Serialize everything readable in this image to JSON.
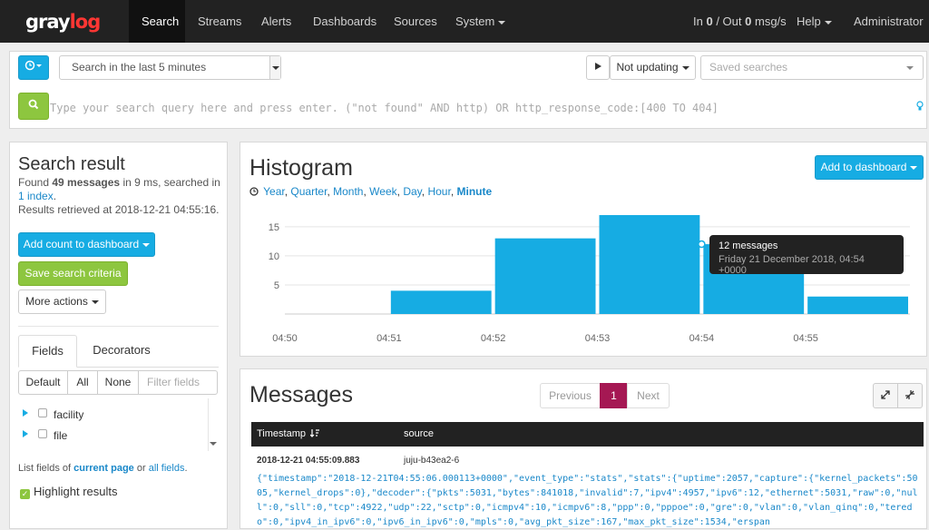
{
  "navbar": {
    "logo_gray": "gray",
    "logo_log": "log",
    "items": [
      "Search",
      "Streams",
      "Alerts",
      "Dashboards",
      "Sources",
      "System"
    ],
    "throughput_in_label": "In",
    "throughput_in": "0",
    "throughput_out_label": "/ Out",
    "throughput_out": "0",
    "throughput_unit": "msg/s",
    "help": "Help",
    "user": "Administrator"
  },
  "search": {
    "time_range": "Search in the last 5 minutes",
    "refresh": "Not updating",
    "saved_searches": "Saved searches",
    "query_placeholder": "Type your search query here and press enter. (\"not found\" AND http) OR http_response_code:[400 TO 404]"
  },
  "sidebar": {
    "title": "Search result",
    "found_prefix": "Found",
    "found_count": "49 messages",
    "found_mid": "in 9 ms, searched in",
    "found_index": "1 index",
    "retrieved": "Results retrieved at 2018-12-21 04:55:16.",
    "add_count": "Add count to dashboard",
    "save_search": "Save search criteria",
    "more_actions": "More actions",
    "tabs": [
      "Fields",
      "Decorators"
    ],
    "filter_buttons": [
      "Default",
      "All",
      "None"
    ],
    "filter_placeholder": "Filter fields",
    "fields": [
      "facility",
      "file"
    ],
    "list_fields_prefix": "List fields of",
    "current_page": "current page",
    "or": "or",
    "all_fields": "all fields",
    "highlight": "Highlight results"
  },
  "histogram": {
    "title": "Histogram",
    "add_to_dashboard": "Add to dashboard",
    "resolutions": [
      "Year",
      "Quarter",
      "Month",
      "Week",
      "Day",
      "Hour",
      "Minute"
    ],
    "active_resolution": "Minute",
    "tooltip_value": "12 messages",
    "tooltip_time": "Friday 21 December 2018, 04:54 +0000"
  },
  "chart_data": {
    "type": "bar",
    "categories": [
      "04:50",
      "04:51",
      "04:52",
      "04:53",
      "04:54",
      "04:55"
    ],
    "values": [
      0,
      4,
      13,
      17,
      12,
      3
    ],
    "yticks": [
      5,
      10,
      15
    ],
    "ylim": [
      0,
      17
    ],
    "bar_color": "#16ace3",
    "grid": true
  },
  "messages": {
    "title": "Messages",
    "pager": [
      "Previous",
      "1",
      "Next"
    ],
    "columns": [
      "Timestamp",
      "source"
    ],
    "row_timestamp": "2018-12-21 04:55:09.883",
    "row_source": "juju-b43ea2-6",
    "row_message": "{\"timestamp\":\"2018-12-21T04:55:06.000113+0000\",\"event_type\":\"stats\",\"stats\":{\"uptime\":2057,\"capture\":{\"kernel_packets\":5005,\"kernel_drops\":0},\"decoder\":{\"pkts\":5031,\"bytes\":841018,\"invalid\":7,\"ipv4\":4957,\"ipv6\":12,\"ethernet\":5031,\"raw\":0,\"null\":0,\"sll\":0,\"tcp\":4922,\"udp\":22,\"sctp\":0,\"icmpv4\":10,\"icmpv6\":8,\"ppp\":0,\"pppoe\":0,\"gre\":0,\"vlan\":0,\"vlan_qinq\":0,\"teredo\":0,\"ipv4_in_ipv6\":0,\"ipv6_in_ipv6\":0,\"mpls\":0,\"avg_pkt_size\":167,\"max_pkt_size\":1534,\"erspan"
  }
}
